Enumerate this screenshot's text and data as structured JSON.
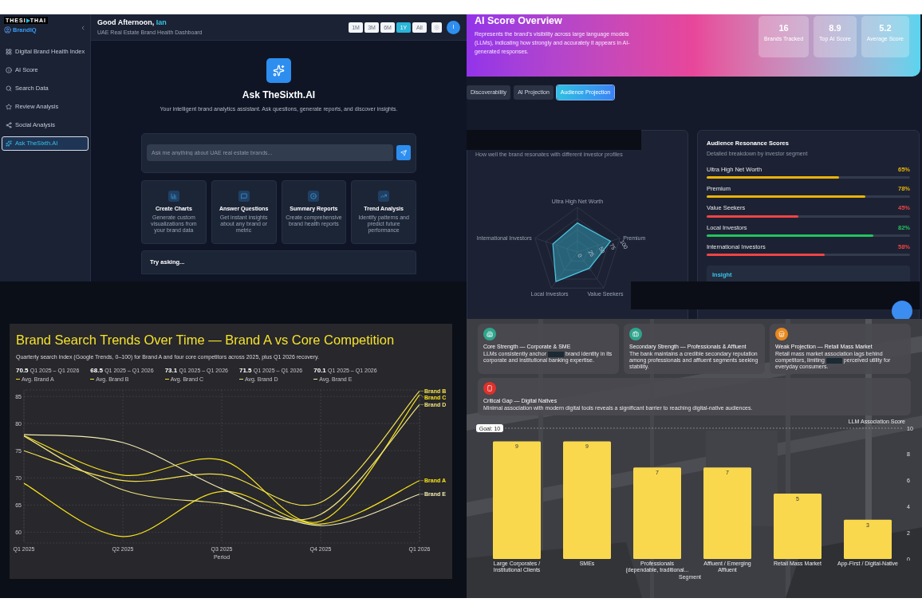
{
  "dashboard": {
    "logo": {
      "left": "THESI",
      "right": "THAI"
    },
    "brand": "BrandIQ",
    "nav": [
      {
        "label": "Digital Brand Health Index",
        "selected": false
      },
      {
        "label": "AI Score",
        "selected": false
      },
      {
        "label": "Search Data",
        "selected": false
      },
      {
        "label": "Review Analysis",
        "selected": false
      },
      {
        "label": "Social Analysis",
        "selected": false
      },
      {
        "label": "Ask TheSixth.AI",
        "selected": true
      }
    ],
    "greeting": "Good Afternoon,",
    "user_name": "Ian",
    "subtitle": "UAE Real Estate Brand Health Dashboard",
    "periods": [
      {
        "label": "1M",
        "selected": false
      },
      {
        "label": "3M",
        "selected": false
      },
      {
        "label": "6M",
        "selected": false
      },
      {
        "label": "1Y",
        "selected": true
      },
      {
        "label": "All",
        "selected": false
      }
    ],
    "avatar": "I",
    "hero": {
      "title": "Ask TheSixth.AI",
      "subtitle": "Your intelligent brand analytics assistant. Ask questions, generate reports, and discover insights."
    },
    "ask_field": {
      "placeholder": "Ask me anything about UAE real estate brands..."
    },
    "features": [
      {
        "title": "Create Charts",
        "text": "Generate custom visualizations from your brand data"
      },
      {
        "title": "Answer Questions",
        "text": "Get instant insights about any brand or metric"
      },
      {
        "title": "Summary Reports",
        "text": "Create comprehensive brand health reports"
      },
      {
        "title": "Trend Analysis",
        "text": "Identify patterns and predict future performance"
      }
    ],
    "try_asking": "Try asking..."
  },
  "ai_score": {
    "title": "AI Score Overview",
    "description": "Represents the brand's visibility across large language models (LLMs), indicating how strongly and accurately it appears in AI-generated responses.",
    "stats": [
      {
        "value": "16",
        "label": "Brands Tracked"
      },
      {
        "value": "8.9",
        "label": "Top AI Score"
      },
      {
        "value": "5.2",
        "label": "Average Score"
      }
    ],
    "tabs": [
      {
        "label": "Discoverability",
        "selected": false
      },
      {
        "label": "AI Projection",
        "selected": false
      },
      {
        "label": "Audience Projection",
        "selected": true
      }
    ],
    "radar": {
      "subtitle": "How well the brand resonates with different investor profiles",
      "chart_data": {
        "type": "radar",
        "categories": [
          "Ultra High Net Worth",
          "Premium",
          "Value Seekers",
          "Local Investors",
          "International Investors"
        ],
        "values": [
          65,
          78,
          45,
          82,
          58
        ],
        "yticks": [
          0,
          25,
          50,
          75,
          100
        ],
        "ylim": [
          0,
          100
        ]
      }
    },
    "resonance": {
      "title": "Audience Resonance Scores",
      "subtitle": "Detailed breakdown by investor segment",
      "items": [
        {
          "label": "Ultra High Net Worth",
          "value": "65%",
          "level": 0.65,
          "color": "#eab308"
        },
        {
          "label": "Premium",
          "value": "78%",
          "level": 0.78,
          "color": "#eab308"
        },
        {
          "label": "Value Seekers",
          "value": "45%",
          "level": 0.45,
          "color": "#ef4444"
        },
        {
          "label": "Local Investors",
          "value": "82%",
          "level": 0.82,
          "color": "#22c55e"
        },
        {
          "label": "International Investors",
          "value": "58%",
          "level": 0.58,
          "color": "#ef4444"
        }
      ],
      "insight_title": "Insight"
    }
  },
  "search_trends": {
    "title": "Brand Search Trends Over Time — Brand A vs Core Competition",
    "subtitle": "Quarterly search index (Google Trends, 0–100) for Brand A and four core competitors across 2025, plus Q1 2026 recovery.",
    "stats": [
      {
        "value": "70.5",
        "range": "Q1 2025 – Q1 2026",
        "label": "Avg. Brand A"
      },
      {
        "value": "68.5",
        "range": "Q1 2025 – Q1 2026",
        "label": "Avg. Brand B"
      },
      {
        "value": "73.1",
        "range": "Q1 2025 – Q1 2026",
        "label": "Avg. Brand C"
      },
      {
        "value": "71.5",
        "range": "Q1 2025 – Q1 2026",
        "label": "Avg. Brand D"
      },
      {
        "value": "70.1",
        "range": "Q1 2025 – Q1 2026",
        "label": "Avg. Brand E"
      }
    ],
    "chart_data": {
      "type": "line",
      "xlabel": "Period",
      "categories": [
        "Q1 2025",
        "Q2 2025",
        "Q3 2025",
        "Q4 2025",
        "Q1 2026"
      ],
      "yticks": [
        60,
        65,
        70,
        75,
        80,
        85
      ],
      "ylim": [
        58,
        86.2
      ],
      "grid": true,
      "legend": "right",
      "series": [
        {
          "name": "Brand A",
          "color": "#f7e11a",
          "values": [
            69,
            59.2,
            67.5,
            61.5,
            69.5
          ]
        },
        {
          "name": "Brand B",
          "color": "#f3e24e",
          "values": [
            75,
            69.5,
            70.6,
            65.5,
            86
          ]
        },
        {
          "name": "Brand C",
          "color": "#f6e21c",
          "values": [
            77.8,
            70.5,
            73.3,
            62,
            85.3
          ]
        },
        {
          "name": "Brand D",
          "color": "#efe37a",
          "values": [
            77.7,
            67.8,
            65.3,
            63.3,
            83.5
          ]
        },
        {
          "name": "Brand E",
          "color": "#f1eab0",
          "values": [
            78,
            76.5,
            68,
            61.2,
            67
          ]
        }
      ]
    }
  },
  "segments": {
    "cards": [
      {
        "title": "Core Strength — Corporate & SME",
        "text_before": "LLMs consistently anchor",
        "redacted": true,
        "text_after": "brand identity in its corporate and institutional banking expertise.",
        "color": "#2fa58c"
      },
      {
        "title": "Secondary Strength — Professionals & Affluent",
        "text_before": "The bank maintains a credible secondary reputation among professionals and affluent segments seeking stability.",
        "redacted": false,
        "color": "#2fa58c"
      },
      {
        "title": "Weak Projection — Retail Mass Market",
        "text_before": "Retail mass market association lags behind competitors, limiting",
        "redacted": true,
        "text_after": "perceived utility for everyday consumers.",
        "color": "#e8891e"
      },
      {
        "title": "Critical Gap — Digital Natives",
        "text_before": "Minimal association with modern digital tools reveals a significant barrier to reaching digital-native audiences.",
        "redacted": false,
        "color": "#e0302b"
      }
    ],
    "chart_data": {
      "type": "bar",
      "xlabel": "Segment",
      "ylabel": "LLM Association Score",
      "categories": [
        "Large Corporates / Institutional Clients",
        "SMEs",
        "Professionals (dependable, traditional...",
        "Affluent / Emerging Affluent",
        "Retail Mass Market",
        "App-First / Digital-Native"
      ],
      "ylim": [
        0,
        10
      ],
      "yticks": [
        0,
        2,
        4,
        6,
        8,
        10
      ],
      "data_labels": true,
      "annotations": [
        "Goal: 10"
      ],
      "series": [
        {
          "color": "#f9d84e",
          "values": [
            9,
            9,
            7,
            7,
            5,
            3
          ]
        }
      ]
    }
  }
}
